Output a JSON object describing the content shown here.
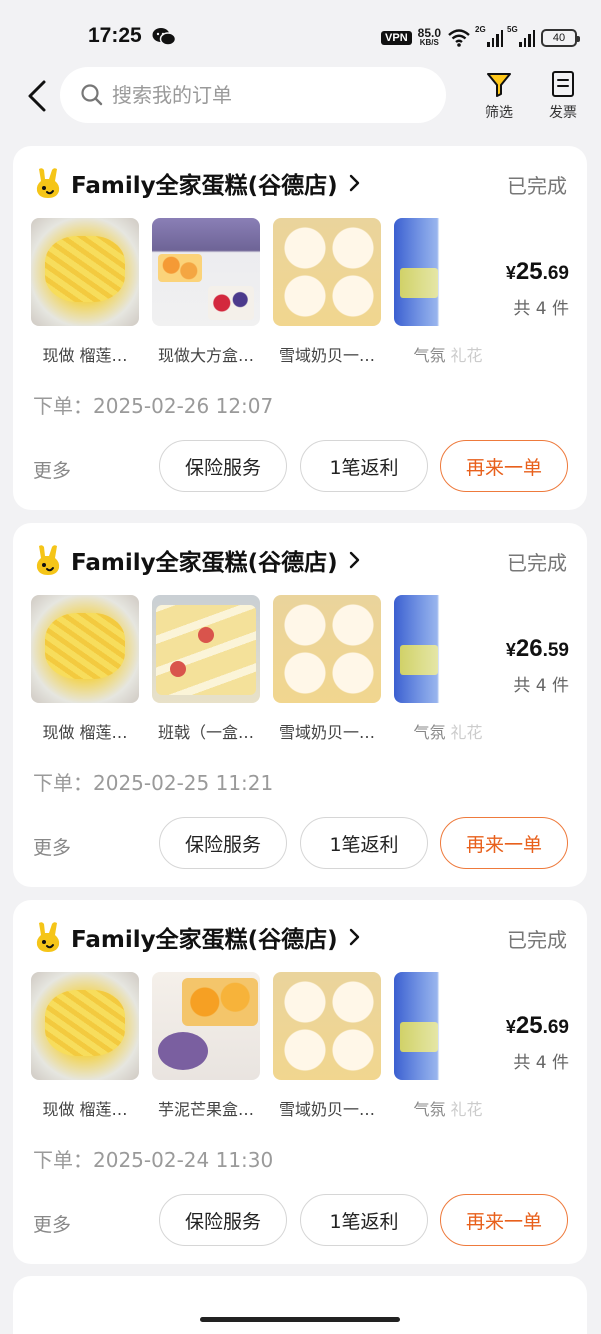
{
  "status_bar": {
    "time": "17:25",
    "vpn": "VPN",
    "speed_value": "85.0",
    "speed_unit": "KB/S",
    "signal1": "2G",
    "signal2": "5G",
    "battery": "40"
  },
  "header": {
    "search_placeholder": "搜索我的订单",
    "filter_label": "筛选",
    "invoice_label": "发票"
  },
  "orders": [
    {
      "store": "Family全家蛋糕(谷德店)",
      "status": "已完成",
      "items": [
        "现做 榴莲…",
        "现做大方盒…",
        "雪域奶贝一…",
        "气氛"
      ],
      "item_extra": "礼花",
      "price_currency": "¥",
      "price_int": "25",
      "price_dec": ".69",
      "count": "共 4 件",
      "order_time_label": "下单：",
      "order_time": "2025-02-26 12:07",
      "more": "更多",
      "btn_insurance": "保险服务",
      "btn_rebate": "1笔返利",
      "btn_reorder": "再来一单"
    },
    {
      "store": "Family全家蛋糕(谷德店)",
      "status": "已完成",
      "items": [
        "现做 榴莲…",
        "班戟（一盒…",
        "雪域奶贝一…",
        "气氛"
      ],
      "item_extra": "礼花",
      "price_currency": "¥",
      "price_int": "26",
      "price_dec": ".59",
      "count": "共 4 件",
      "order_time_label": "下单：",
      "order_time": "2025-02-25 11:21",
      "more": "更多",
      "btn_insurance": "保险服务",
      "btn_rebate": "1笔返利",
      "btn_reorder": "再来一单"
    },
    {
      "store": "Family全家蛋糕(谷德店)",
      "status": "已完成",
      "items": [
        "现做 榴莲…",
        "芋泥芒果盒…",
        "雪域奶贝一…",
        "气氛"
      ],
      "item_extra": "礼花",
      "price_currency": "¥",
      "price_int": "25",
      "price_dec": ".69",
      "count": "共 4 件",
      "order_time_label": "下单：",
      "order_time": "2025-02-24 11:30",
      "more": "更多",
      "btn_insurance": "保险服务",
      "btn_rebate": "1笔返利",
      "btn_reorder": "再来一单"
    }
  ],
  "colors": {
    "accent": "#e8601c",
    "logo_yellow": "#f5c518",
    "background": "#f2f2f4"
  }
}
